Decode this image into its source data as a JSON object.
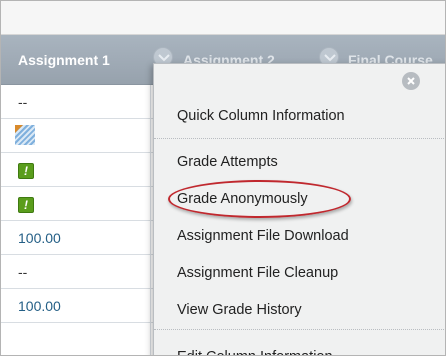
{
  "columns": [
    {
      "label": "Assignment 1"
    },
    {
      "label": "Assignment 2"
    },
    {
      "label": "Final Course"
    }
  ],
  "rows": [
    {
      "type": "text",
      "value": "--"
    },
    {
      "type": "in-progress",
      "value": ""
    },
    {
      "type": "needs-grading",
      "value": "!"
    },
    {
      "type": "needs-grading",
      "value": "!"
    },
    {
      "type": "number",
      "value": "100.00"
    },
    {
      "type": "text",
      "value": "--"
    },
    {
      "type": "number",
      "value": "100.00"
    },
    {
      "type": "text",
      "value": ""
    }
  ],
  "menu": {
    "items": [
      {
        "label": "Quick Column Information"
      },
      {
        "label": "Grade Attempts"
      },
      {
        "label": "Grade Anonymously",
        "highlighted": true
      },
      {
        "label": "Assignment File Download"
      },
      {
        "label": "Assignment File Cleanup"
      },
      {
        "label": "View Grade History"
      },
      {
        "label": "Edit Column Information"
      }
    ]
  },
  "colors": {
    "header": "#a0abb6",
    "menu_bg": "#f0f1f1",
    "highlight_ring": "#c0282e",
    "needs_grading": "#5a9d1c",
    "link_number": "#245f86"
  }
}
